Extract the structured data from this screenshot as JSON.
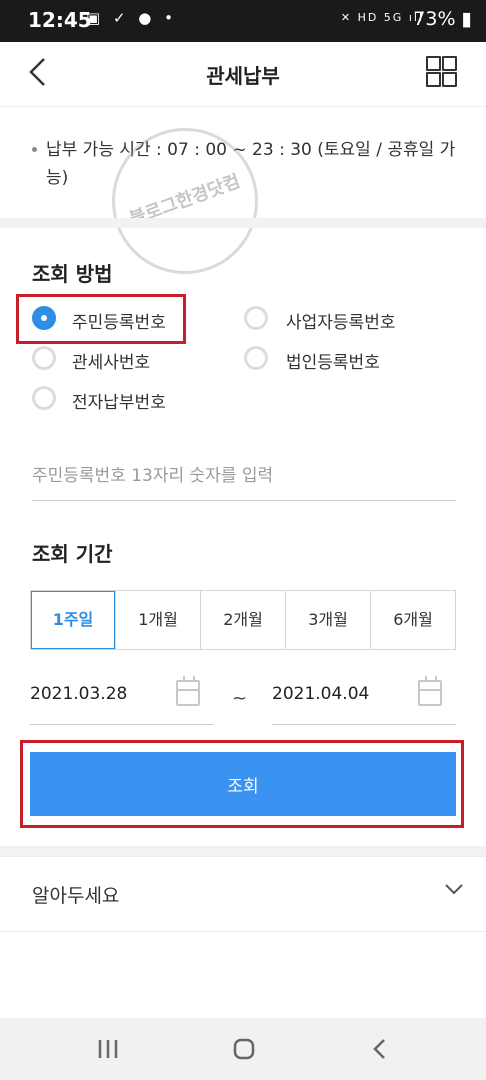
{
  "status_bar": {
    "time": "12:45",
    "battery": "73%"
  },
  "header": {
    "title": "관세납부"
  },
  "notice": {
    "text": "납부 가능 시간 : 07 : 00 ~ 23 : 30 (토요일 / 공휴일 가능)"
  },
  "watermark": {
    "text": "블로그한경닷컴"
  },
  "query_method": {
    "title": "조회 방법",
    "options": [
      {
        "label": "주민등록번호",
        "selected": true
      },
      {
        "label": "사업자등록번호",
        "selected": false
      },
      {
        "label": "관세사번호",
        "selected": false
      },
      {
        "label": "법인등록번호",
        "selected": false
      },
      {
        "label": "전자납부번호",
        "selected": false
      }
    ]
  },
  "id_input": {
    "placeholder": "주민등록번호 13자리 숫자를 입력",
    "value": ""
  },
  "query_period": {
    "title": "조회 기간",
    "options": [
      "1주일",
      "1개월",
      "2개월",
      "3개월",
      "6개월"
    ],
    "selected": "1주일",
    "start_date": "2021.03.28",
    "separator": "~",
    "end_date": "2021.04.04"
  },
  "submit": {
    "label": "조회"
  },
  "accordion": {
    "label": "알아두세요"
  },
  "colors": {
    "accent": "#3a93f0",
    "highlight": "#c81e2a"
  },
  "icons": {
    "back": "chevron-left-icon",
    "menu": "grid-menu-icon",
    "calendar": "calendar-icon",
    "expand": "chevron-down-icon",
    "nav_recent": "recent-apps-icon",
    "nav_home": "home-icon",
    "nav_back": "nav-back-icon"
  }
}
